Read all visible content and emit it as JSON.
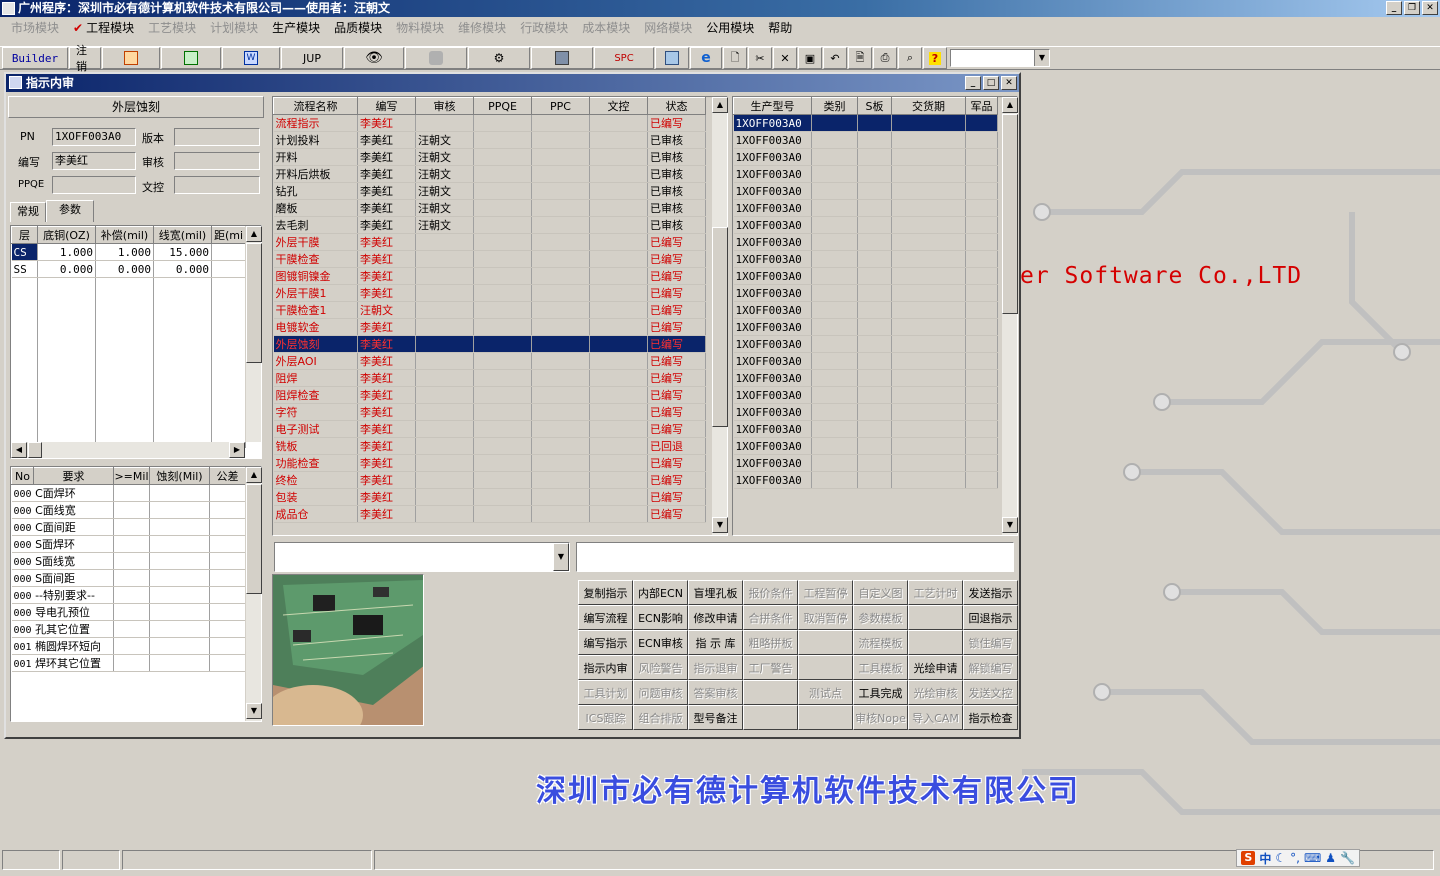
{
  "app": {
    "title": "广州程序：深圳市必有德计算机软件技术有限公司——使用者：汪朝文"
  },
  "menu": [
    {
      "label": "市场模块",
      "dim": true
    },
    {
      "label": "工程模块",
      "dim": false,
      "checked": true
    },
    {
      "label": "工艺模块",
      "dim": true
    },
    {
      "label": "计划模块",
      "dim": true
    },
    {
      "label": "生产模块",
      "dim": false
    },
    {
      "label": "品质模块",
      "dim": false
    },
    {
      "label": "物料模块",
      "dim": true
    },
    {
      "label": "维修模块",
      "dim": true
    },
    {
      "label": "行政模块",
      "dim": true
    },
    {
      "label": "成本模块",
      "dim": true
    },
    {
      "label": "网络模块",
      "dim": true
    },
    {
      "label": "公用模块",
      "dim": false
    },
    {
      "label": "帮助",
      "dim": false
    }
  ],
  "toolbar": {
    "builder": "Builder",
    "logout": "注销",
    "jup": "JUP",
    "spc": "SPC"
  },
  "window": {
    "title": "指示内审"
  },
  "left": {
    "section_title": "外层蚀刻",
    "pn_label": "PN",
    "pn_value": "1XOFF003A0",
    "version_label": "版本",
    "version_value": "",
    "writer_label": "编写",
    "writer_value": "李美红",
    "review_label": "审核",
    "review_value": "",
    "ppqe_label": "PPQE",
    "ppqe_value": "",
    "doc_label": "文控",
    "doc_value": "",
    "tabs": [
      "常规",
      "参数"
    ],
    "param_headers": [
      "层",
      "底铜(OZ)",
      "补偿(mil)",
      "线宽(mil)",
      "距(mi"
    ],
    "param_rows": [
      [
        "CS",
        "1.000",
        "1.000",
        "15.000",
        ""
      ],
      [
        "SS",
        "0.000",
        "0.000",
        "0.000",
        ""
      ]
    ],
    "req_headers": [
      "No",
      "要求",
      ">=Mil",
      "蚀刻(Mil)",
      "公差"
    ],
    "req_rows": [
      [
        "000",
        "C面焊环"
      ],
      [
        "000",
        "C面线宽"
      ],
      [
        "000",
        "C面间距"
      ],
      [
        "000",
        "S面焊环"
      ],
      [
        "000",
        "S面线宽"
      ],
      [
        "000",
        "S面间距"
      ],
      [
        "000",
        "--特别要求--"
      ],
      [
        "000",
        "导电孔预位"
      ],
      [
        "000",
        "孔其它位置"
      ],
      [
        "001",
        "椭圆焊环短向"
      ],
      [
        "001",
        "焊环其它位置"
      ]
    ]
  },
  "flow": {
    "headers": [
      "流程名称",
      "编写",
      "审核",
      "PPQE",
      "PPC",
      "文控",
      "状态"
    ],
    "rows": [
      {
        "name": "流程指示",
        "writer": "李美红",
        "reviewer": "",
        "status": "已编写",
        "style": "red"
      },
      {
        "name": "计划投料",
        "writer": "李美红",
        "reviewer": "汪朝文",
        "status": "已审核",
        "style": ""
      },
      {
        "name": "开料",
        "writer": "李美红",
        "reviewer": "汪朝文",
        "status": "已审核",
        "style": ""
      },
      {
        "name": "开料后烘板",
        "writer": "李美红",
        "reviewer": "汪朝文",
        "status": "已审核",
        "style": ""
      },
      {
        "name": "钻孔",
        "writer": "李美红",
        "reviewer": "汪朝文",
        "status": "已审核",
        "style": ""
      },
      {
        "name": "磨板",
        "writer": "李美红",
        "reviewer": "汪朝文",
        "status": "已审核",
        "style": ""
      },
      {
        "name": "去毛刺",
        "writer": "李美红",
        "reviewer": "汪朝文",
        "status": "已审核",
        "style": ""
      },
      {
        "name": "外层干膜",
        "writer": "李美红",
        "reviewer": "",
        "status": "已编写",
        "style": "red"
      },
      {
        "name": "干膜检查",
        "writer": "李美红",
        "reviewer": "",
        "status": "已编写",
        "style": "red"
      },
      {
        "name": "图镀铜镍金",
        "writer": "李美红",
        "reviewer": "",
        "status": "已编写",
        "style": "red"
      },
      {
        "name": "外层干膜1",
        "writer": "李美红",
        "reviewer": "",
        "status": "已编写",
        "style": "red"
      },
      {
        "name": "干膜检查1",
        "writer": "汪朝文",
        "reviewer": "",
        "status": "已编写",
        "style": "red"
      },
      {
        "name": "电镀软金",
        "writer": "李美红",
        "reviewer": "",
        "status": "已编写",
        "style": "red"
      },
      {
        "name": "外层蚀刻",
        "writer": "李美红",
        "reviewer": "",
        "status": "已编写",
        "style": "sel"
      },
      {
        "name": "外层AOI",
        "writer": "李美红",
        "reviewer": "",
        "status": "已编写",
        "style": "red"
      },
      {
        "name": "阻焊",
        "writer": "李美红",
        "reviewer": "",
        "status": "已编写",
        "style": "red"
      },
      {
        "name": "阻焊检查",
        "writer": "李美红",
        "reviewer": "",
        "status": "已编写",
        "style": "red"
      },
      {
        "name": "字符",
        "writer": "李美红",
        "reviewer": "",
        "status": "已编写",
        "style": "red"
      },
      {
        "name": "电子测试",
        "writer": "李美红",
        "reviewer": "",
        "status": "已编写",
        "style": "red"
      },
      {
        "name": "铣板",
        "writer": "李美红",
        "reviewer": "",
        "status": "已回退",
        "style": "red"
      },
      {
        "name": "功能检查",
        "writer": "李美红",
        "reviewer": "",
        "status": "已编写",
        "style": "red"
      },
      {
        "name": "终检",
        "writer": "李美红",
        "reviewer": "",
        "status": "已编写",
        "style": "red"
      },
      {
        "name": "包装",
        "writer": "李美红",
        "reviewer": "",
        "status": "已编写",
        "style": "red"
      },
      {
        "name": "成品仓",
        "writer": "李美红",
        "reviewer": "",
        "status": "已编写",
        "style": "red"
      }
    ]
  },
  "models": {
    "headers": [
      "生产型号",
      "类别",
      "S板",
      "交货期",
      "军品"
    ],
    "rows": [
      "1XOFF003A0",
      "1XOFF003A0",
      "1XOFF003A0",
      "1XOFF003A0",
      "1XOFF003A0",
      "1XOFF003A0",
      "1XOFF003A0",
      "1XOFF003A0",
      "1XOFF003A0",
      "1XOFF003A0",
      "1XOFF003A0",
      "1XOFF003A0",
      "1XOFF003A0",
      "1XOFF003A0",
      "1XOFF003A0",
      "1XOFF003A0",
      "1XOFF003A0",
      "1XOFF003A0",
      "1XOFF003A0",
      "1XOFF003A0",
      "1XOFF003A0",
      "1XOFF003A0"
    ]
  },
  "actions": [
    [
      {
        "t": "复制指示",
        "d": false
      },
      {
        "t": "内部ECN",
        "d": false
      },
      {
        "t": "盲埋孔板",
        "d": false
      },
      {
        "t": "报价条件",
        "d": true
      },
      {
        "t": "工程暂停",
        "d": true
      },
      {
        "t": "自定义图",
        "d": true
      },
      {
        "t": "工艺计时",
        "d": true
      },
      {
        "t": "发送指示",
        "d": false
      }
    ],
    [
      {
        "t": "编写流程",
        "d": false
      },
      {
        "t": "ECN影响",
        "d": false
      },
      {
        "t": "修改申请",
        "d": false
      },
      {
        "t": "合拼条件",
        "d": true
      },
      {
        "t": "取消暂停",
        "d": true
      },
      {
        "t": "参数模板",
        "d": true
      },
      {
        "t": "",
        "d": true
      },
      {
        "t": "回退指示",
        "d": false
      }
    ],
    [
      {
        "t": "编写指示",
        "d": false
      },
      {
        "t": "ECN审核",
        "d": false
      },
      {
        "t": "指 示 库",
        "d": false
      },
      {
        "t": "粗略拼板",
        "d": true
      },
      {
        "t": "",
        "d": true
      },
      {
        "t": "流程模板",
        "d": true
      },
      {
        "t": "",
        "d": true
      },
      {
        "t": "锁住编写",
        "d": true
      }
    ],
    [
      {
        "t": "指示内审",
        "d": false
      },
      {
        "t": "风险警告",
        "d": true
      },
      {
        "t": "指示退审",
        "d": true
      },
      {
        "t": "工厂警告",
        "d": true
      },
      {
        "t": "",
        "d": true
      },
      {
        "t": "工具模板",
        "d": true
      },
      {
        "t": "光绘申请",
        "d": false
      },
      {
        "t": "解锁编写",
        "d": true
      }
    ],
    [
      {
        "t": "工具计划",
        "d": true
      },
      {
        "t": "问题审核",
        "d": true
      },
      {
        "t": "答案审核",
        "d": true
      },
      {
        "t": "",
        "d": true
      },
      {
        "t": "测试点",
        "d": true
      },
      {
        "t": "工具完成",
        "d": false
      },
      {
        "t": "光绘审核",
        "d": true
      },
      {
        "t": "发送文控",
        "d": true
      }
    ],
    [
      {
        "t": "ICS跟踪",
        "d": true
      },
      {
        "t": "组合排版",
        "d": true
      },
      {
        "t": "型号备注",
        "d": false
      },
      {
        "t": "",
        "d": true
      },
      {
        "t": "",
        "d": true
      },
      {
        "t": "审核Nope",
        "d": true
      },
      {
        "t": "导入CAM",
        "d": true
      },
      {
        "t": "指示检查",
        "d": false
      }
    ]
  ],
  "bg": {
    "text_en": "er Software Co.,LTD",
    "text_cn": "深圳市必有德计算机软件技术有限公司"
  },
  "ime": {
    "label": "中"
  }
}
